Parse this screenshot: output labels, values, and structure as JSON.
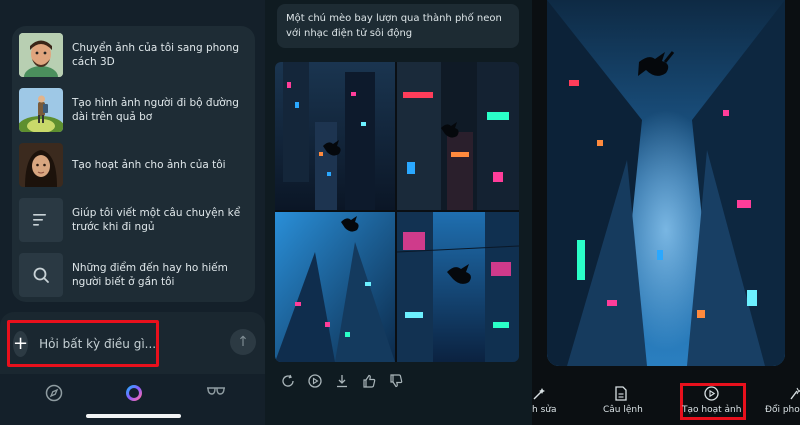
{
  "panel1": {
    "suggestions": [
      {
        "label": "Chuyển ảnh của tôi sang phong cách 3D",
        "icon": "avatar-3d-thumbnail"
      },
      {
        "label": "Tạo hình ảnh người đi bộ đường dài trên quả bơ",
        "icon": "hiker-avocado-thumbnail"
      },
      {
        "label": "Tạo hoạt ảnh cho ảnh của tôi",
        "icon": "portrait-thumbnail"
      },
      {
        "label": "Giúp tôi viết một câu chuyện kể trước khi đi ngủ",
        "icon": "text-lines-icon"
      },
      {
        "label": "Những điểm đến hay ho hiếm người biết ở gần tôi",
        "icon": "search-icon"
      }
    ],
    "input": {
      "placeholder": "Hỏi bất kỳ điều gì..."
    },
    "nav": [
      "compass-icon",
      "copilot-logo-icon",
      "glasses-icon"
    ]
  },
  "panel2": {
    "prompt": "Một chú mèo bay lượn qua thành phố neon với nhạc điện tử sôi động",
    "actions": [
      "refresh-icon",
      "play-circle-icon",
      "download-icon",
      "thumbs-up-icon",
      "thumbs-down-icon"
    ]
  },
  "panel3": {
    "tools": [
      {
        "label": "h sửa",
        "icon": "edit-wand-icon"
      },
      {
        "label": "Câu lệnh",
        "icon": "document-icon"
      },
      {
        "label": "Tạo hoạt ảnh",
        "icon": "play-circle-icon"
      },
      {
        "label": "Đổi phon",
        "icon": "style-wand-icon"
      }
    ]
  },
  "colors": {
    "highlight": "#e8101c",
    "accent_blue": "#2aa8ff",
    "accent_pink": "#ff3d9a"
  }
}
